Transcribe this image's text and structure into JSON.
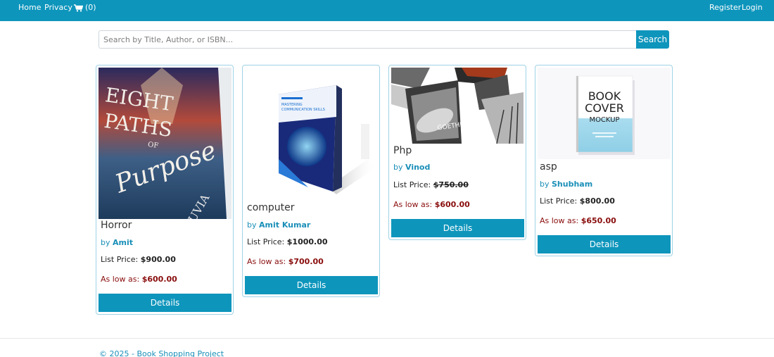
{
  "nav": {
    "home": "Home",
    "privacy": "Privacy",
    "cart_count": "(0)",
    "cart_icon": "cart-icon",
    "register": "Register",
    "login": "Login"
  },
  "search": {
    "placeholder": "Search by Title, Author, or ISBN...",
    "value": "",
    "button": "Search"
  },
  "books": [
    {
      "title": "Horror",
      "by": "by",
      "author": "Amit",
      "list_label": "List Price:",
      "list_price": "$900.00",
      "low_label": "As low as:",
      "low_price": "$600.00",
      "details": "Details",
      "cover_text": {
        "line1": "EIGHT",
        "line2": "PATHS",
        "line3": "OF",
        "line4": "Purpose",
        "author": "TUVIA"
      }
    },
    {
      "title": "computer",
      "by": "by",
      "author": "Amit Kumar",
      "list_label": "List Price:",
      "list_price": "$1000.00",
      "low_label": "As low as:",
      "low_price": "$700.00",
      "details": "Details",
      "cover_text": {
        "line1": "MASTERING",
        "line2": "COMMUNICATION SKILLS"
      }
    },
    {
      "title": "Php",
      "by": "by",
      "author": "Vinod",
      "list_label": "List Price:",
      "list_price": "$750.00",
      "low_label": "As low as:",
      "low_price": "$600.00",
      "details": "Details",
      "cover_text": {
        "line1": "GOETHE"
      }
    },
    {
      "title": "asp",
      "by": "by",
      "author": "Shubham",
      "list_label": "List Price:",
      "list_price": "$800.00",
      "low_label": "As low as:",
      "low_price": "$650.00",
      "details": "Details",
      "cover_text": {
        "line1": "BOOK",
        "line2": "COVER",
        "line3": "MOCKUP"
      }
    }
  ],
  "footer": {
    "text": "© 2025 - Book Shopping Project"
  },
  "colors": {
    "primary": "#0e95bc",
    "sale": "#8a0d0d",
    "author": "#1a8fb8"
  }
}
